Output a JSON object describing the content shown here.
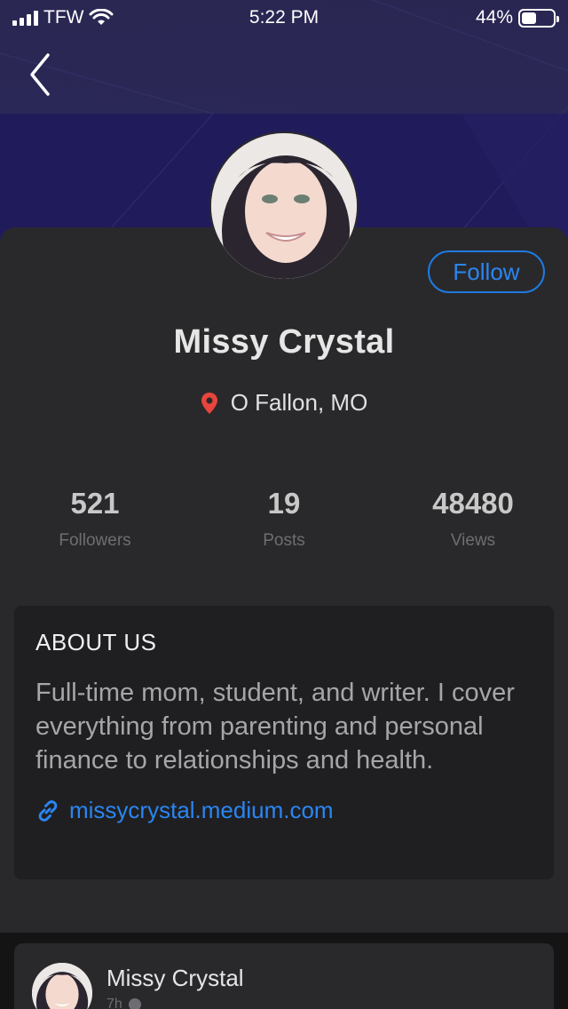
{
  "status_bar": {
    "carrier": "TFW",
    "time": "5:22 PM",
    "battery_percent": "44%",
    "battery_level": 0.44,
    "signal_bars": 4
  },
  "header": {
    "back_icon": "chevron-left-icon"
  },
  "profile": {
    "name": "Missy Crystal",
    "location": "O Fallon, MO",
    "location_icon": "map-pin-icon",
    "follow_label": "Follow"
  },
  "stats": [
    {
      "value": "521",
      "label": "Followers"
    },
    {
      "value": "19",
      "label": "Posts"
    },
    {
      "value": "48480",
      "label": "Views"
    }
  ],
  "about": {
    "heading": "ABOUT US",
    "bio": "Full-time mom, student, and writer. I cover everything from parenting and personal finance to relationships and health.",
    "link_icon": "link-icon",
    "link": "missycrystal.medium.com"
  },
  "feed": {
    "first_post": {
      "author": "Missy Crystal",
      "time": "7h"
    }
  },
  "colors": {
    "accent": "#2a86f3",
    "card": "#29292b",
    "header": "#221e5c",
    "pin": "#e8453c"
  }
}
